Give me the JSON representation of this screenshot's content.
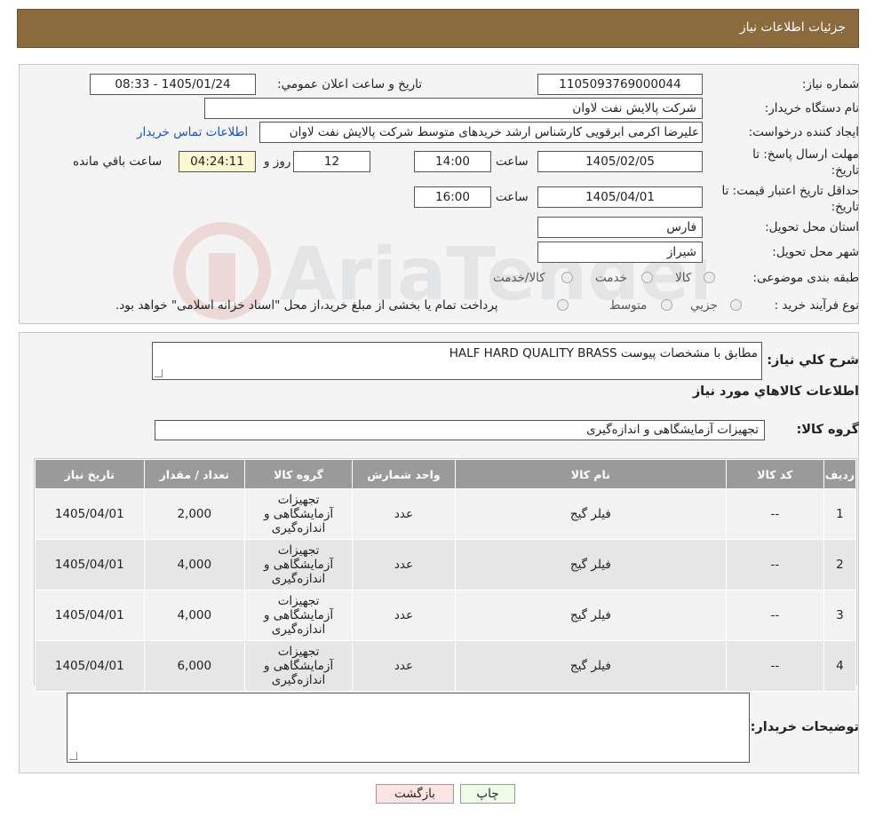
{
  "header": {
    "title": "جزئیات اطلاعات نیاز"
  },
  "form": {
    "need_number_label": "شماره نياز:",
    "need_number": "1105093769000044",
    "announce_label": "تاريخ و ساعت اعلان عمومي:",
    "announce_value": "1405/01/24 - 08:33",
    "buyer_org_label": "نام دستگاه خريدار:",
    "buyer_org": "شركت پالايش نفت لاوان",
    "creator_label": "ايجاد كننده درخواست:",
    "creator": "عليرضا اكرمی ابرقویی کارشناس ارشد خريدهای متوسط شركت پالايش نفت لاوان",
    "contact_link": "اطلاعات تماس خريدار",
    "reply_label_1": "مهلت ارسال پاسخ: تا",
    "reply_label_2": "تاريخ:",
    "reply_date": "1405/02/05",
    "time_label": "ساعت",
    "reply_time": "14:00",
    "days_value": "12",
    "days_label": "روز و",
    "remaining_time": "04:24:11",
    "remaining_label": "ساعت باقي مانده",
    "validity_label_1": "حداقل تاريخ اعتبار قيمت: تا",
    "validity_label_2": "تاريخ:",
    "validity_date": "1405/04/01",
    "validity_time": "16:00",
    "province_label": "استان محل تحويل:",
    "province": "فارس",
    "city_label": "شهر محل تحويل:",
    "city": "شيراز",
    "category_label": "طبقه بندی موضوعی:",
    "category_options": [
      "كالا",
      "خدمت",
      "كالا/خدمت"
    ],
    "process_label": "نوع فرآيند خريد :",
    "process_options": [
      "جزيي",
      "متوسط"
    ],
    "process_note": "پرداخت تمام يا بخشی از مبلغ خريد،از محل \"اسناد خزانه اسلامی\" خواهد بود."
  },
  "description": {
    "label": "شرح كلي نياز:",
    "value": "HALF HARD QUALITY BRASS مطابق با مشخصات پیوست"
  },
  "goods": {
    "section_title": "اطلاعات كالاهاي مورد نياز",
    "group_label": "گروه كالا:",
    "group_value": "تجهیزات آزمایشگاهی و اندازه‌گیری",
    "columns": [
      "رديف",
      "كد كالا",
      "نام كالا",
      "واحد شمارش",
      "گروه كالا",
      "تعداد / مقدار",
      "تاريخ نياز"
    ],
    "rows": [
      {
        "row": "1",
        "code": "--",
        "name": "فیلر گیج",
        "unit": "عدد",
        "group": "تجهیزات آزمایشگاهی و اندازه‌گیری",
        "qty": "2,000",
        "date": "1405/04/01"
      },
      {
        "row": "2",
        "code": "--",
        "name": "فیلر گیج",
        "unit": "عدد",
        "group": "تجهیزات آزمایشگاهی و اندازه‌گیری",
        "qty": "4,000",
        "date": "1405/04/01"
      },
      {
        "row": "3",
        "code": "--",
        "name": "فیلر گیج",
        "unit": "عدد",
        "group": "تجهیزات آزمایشگاهی و اندازه‌گیری",
        "qty": "4,000",
        "date": "1405/04/01"
      },
      {
        "row": "4",
        "code": "--",
        "name": "فیلر گیج",
        "unit": "عدد",
        "group": "تجهیزات آزمایشگاهی و اندازه‌گیری",
        "qty": "6,000",
        "date": "1405/04/01"
      }
    ]
  },
  "notes": {
    "label": "توضيحات خريدار:",
    "value": ""
  },
  "buttons": {
    "print": "چاپ",
    "back": "بازگشت"
  },
  "colors": {
    "header_bg": "#8b6a3e",
    "table_head": "#9a9a9a",
    "link": "#1a4fc7"
  }
}
